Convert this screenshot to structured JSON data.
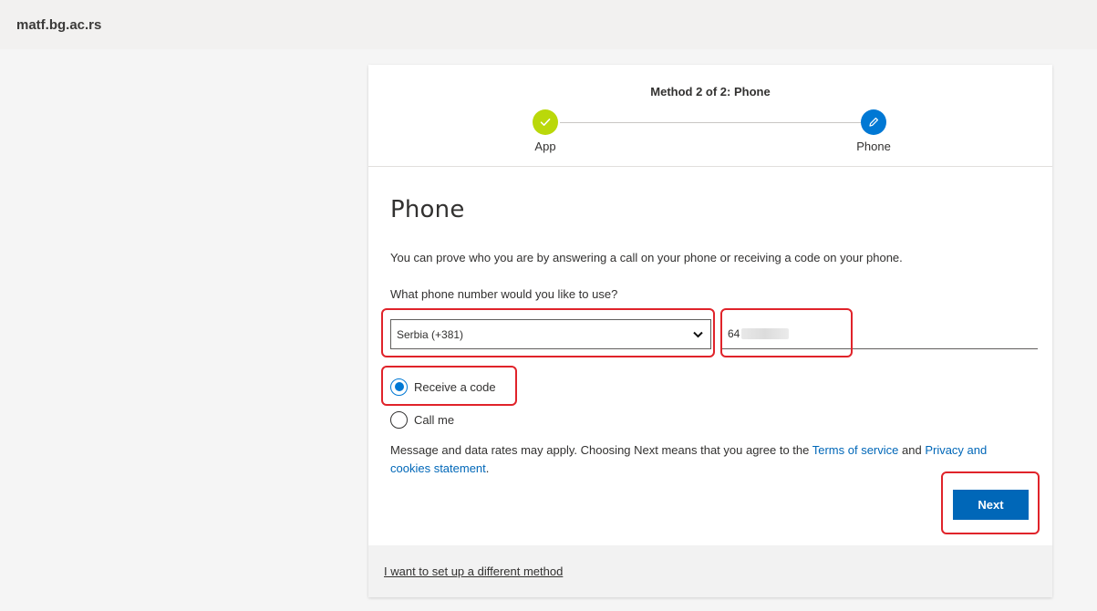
{
  "header": {
    "org_name": "matf.bg.ac.rs"
  },
  "progress": {
    "title": "Method 2 of 2: Phone",
    "steps": [
      {
        "label": "App",
        "status": "complete",
        "icon": "check-icon",
        "color": "#bad80a"
      },
      {
        "label": "Phone",
        "status": "current",
        "icon": "pencil-icon",
        "color": "#0078d4"
      }
    ]
  },
  "form": {
    "title": "Phone",
    "description": "You can prove who you are by answering a call on your phone or receiving a code on your phone.",
    "question": "What phone number would you like to use?",
    "country": {
      "value": "Serbia (+381)"
    },
    "phone": {
      "value": "64"
    },
    "options": [
      {
        "label": "Receive a code",
        "selected": true
      },
      {
        "label": "Call me",
        "selected": false
      }
    ],
    "terms": {
      "text_before": "Message and data rates may apply. Choosing Next means that you agree to the ",
      "terms_link": "Terms of service",
      "text_middle": " and ",
      "privacy_link": "Privacy and cookies statement",
      "text_after": "."
    },
    "next_label": "Next"
  },
  "footer": {
    "different_method_link": "I want to set up a different method"
  },
  "colors": {
    "accent": "#0078d4",
    "button": "#0067b8",
    "success": "#bad80a",
    "highlight": "#e0232a"
  }
}
